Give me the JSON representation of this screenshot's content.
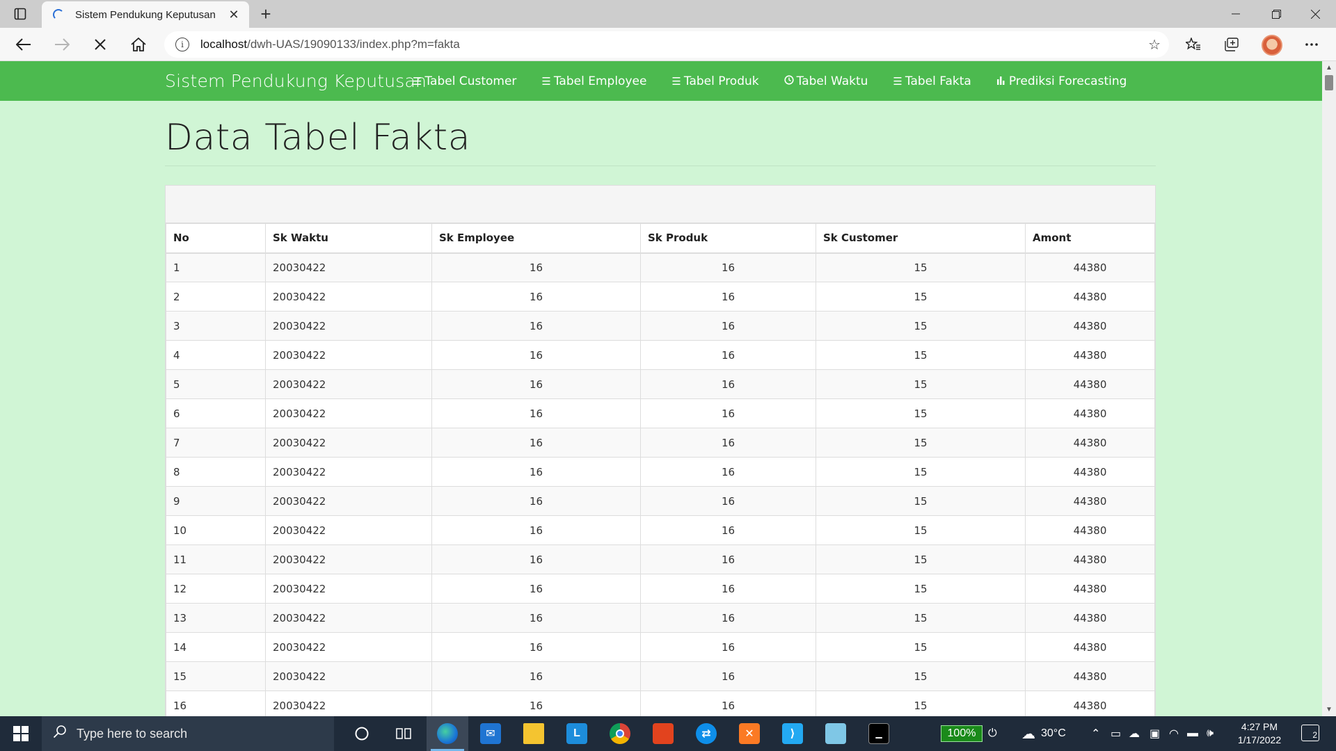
{
  "browser": {
    "tab_title": "Sistem Pendukung Keputusan",
    "url_host": "localhost",
    "url_path": "/dwh-UAS/19090133/index.php?m=fakta"
  },
  "navbar": {
    "brand": "Sistem Pendukung Keputusan",
    "links": [
      {
        "label": "Tabel Customer",
        "icon": "table-icon"
      },
      {
        "label": "Tabel Employee",
        "icon": "table-icon"
      },
      {
        "label": "Tabel Produk",
        "icon": "table-icon"
      },
      {
        "label": "Tabel Waktu",
        "icon": "clock-icon"
      },
      {
        "label": "Tabel Fakta",
        "icon": "table-icon"
      },
      {
        "label": "Prediksi Forecasting",
        "icon": "bar-chart-icon"
      }
    ]
  },
  "main": {
    "title": "Data Tabel Fakta",
    "table": {
      "columns": [
        "No",
        "Sk Waktu",
        "Sk Employee",
        "Sk Produk",
        "Sk Customer",
        "Amont"
      ],
      "rows": [
        [
          "1",
          "20030422",
          "16",
          "16",
          "15",
          "44380"
        ],
        [
          "2",
          "20030422",
          "16",
          "16",
          "15",
          "44380"
        ],
        [
          "3",
          "20030422",
          "16",
          "16",
          "15",
          "44380"
        ],
        [
          "4",
          "20030422",
          "16",
          "16",
          "15",
          "44380"
        ],
        [
          "5",
          "20030422",
          "16",
          "16",
          "15",
          "44380"
        ],
        [
          "6",
          "20030422",
          "16",
          "16",
          "15",
          "44380"
        ],
        [
          "7",
          "20030422",
          "16",
          "16",
          "15",
          "44380"
        ],
        [
          "8",
          "20030422",
          "16",
          "16",
          "15",
          "44380"
        ],
        [
          "9",
          "20030422",
          "16",
          "16",
          "15",
          "44380"
        ],
        [
          "10",
          "20030422",
          "16",
          "16",
          "15",
          "44380"
        ],
        [
          "11",
          "20030422",
          "16",
          "16",
          "15",
          "44380"
        ],
        [
          "12",
          "20030422",
          "16",
          "16",
          "15",
          "44380"
        ],
        [
          "13",
          "20030422",
          "16",
          "16",
          "15",
          "44380"
        ],
        [
          "14",
          "20030422",
          "16",
          "16",
          "15",
          "44380"
        ],
        [
          "15",
          "20030422",
          "16",
          "16",
          "15",
          "44380"
        ],
        [
          "16",
          "20030422",
          "16",
          "16",
          "15",
          "44380"
        ]
      ]
    }
  },
  "taskbar": {
    "search_placeholder": "Type here to search",
    "battery_percent": "100%",
    "weather": "30°C",
    "time": "4:27 PM",
    "date": "1/17/2022",
    "notification_count": "2"
  },
  "colors": {
    "navbar": "#4cba4f",
    "page_background": "#d0f5d5",
    "taskbar": "#1f2b3a"
  }
}
